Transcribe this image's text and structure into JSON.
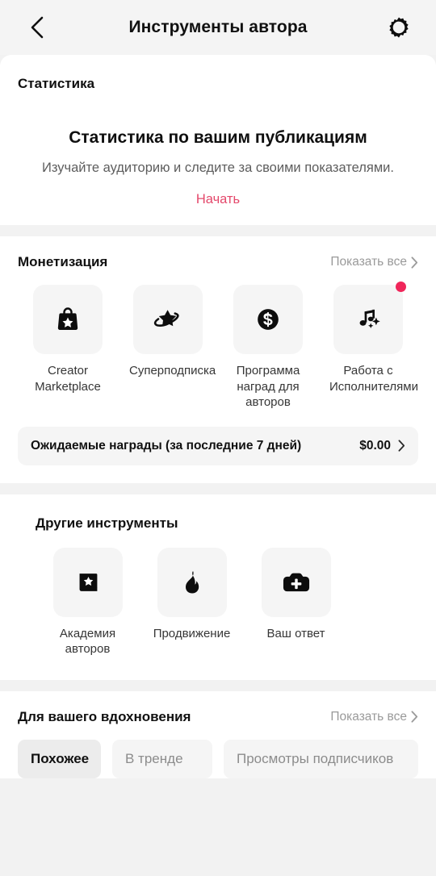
{
  "header": {
    "back_icon": "chevron-left-icon",
    "title": "Инструменты автора",
    "settings_icon": "gear-icon"
  },
  "statistics": {
    "section_label": "Статистика",
    "empty_title": "Статистика по вашим публикациям",
    "empty_subtitle": "Изучайте аудиторию и следите за своими показателями.",
    "cta_label": "Начать",
    "cta_color": "#e4486b"
  },
  "monetization": {
    "title": "Монетизация",
    "show_all": "Показать все",
    "chevron": "›",
    "items": [
      {
        "label": "Creator Marketplace",
        "icon": "shopping-bag-star-icon",
        "badge": false
      },
      {
        "label": "Суперподписка",
        "icon": "star-orbit-icon",
        "badge": false
      },
      {
        "label": "Программа наград для авторов",
        "icon": "dollar-coin-icon",
        "badge": false
      },
      {
        "label": "Работа с Исполнителями",
        "icon": "music-note-sparkle-icon",
        "badge": true
      }
    ],
    "badge_color": "#f0265a",
    "rewards": {
      "label": "Ожидаемые награды (за последние 7 дней)",
      "value": "$0.00",
      "chevron": "›"
    }
  },
  "other_tools": {
    "title": "Другие инструменты",
    "items": [
      {
        "label": "Академия авторов",
        "icon": "book-star-icon"
      },
      {
        "label": "Продвижение",
        "icon": "flame-icon"
      },
      {
        "label": "Ваш ответ",
        "icon": "camera-plus-icon"
      }
    ]
  },
  "inspiration": {
    "title": "Для вашего вдохновения",
    "show_all": "Показать все",
    "chevron": "›",
    "tabs": [
      {
        "label": "Похожее",
        "active": true
      },
      {
        "label": "В тренде",
        "active": false
      },
      {
        "label": "Просмотры подписчиков",
        "active": false
      }
    ]
  }
}
